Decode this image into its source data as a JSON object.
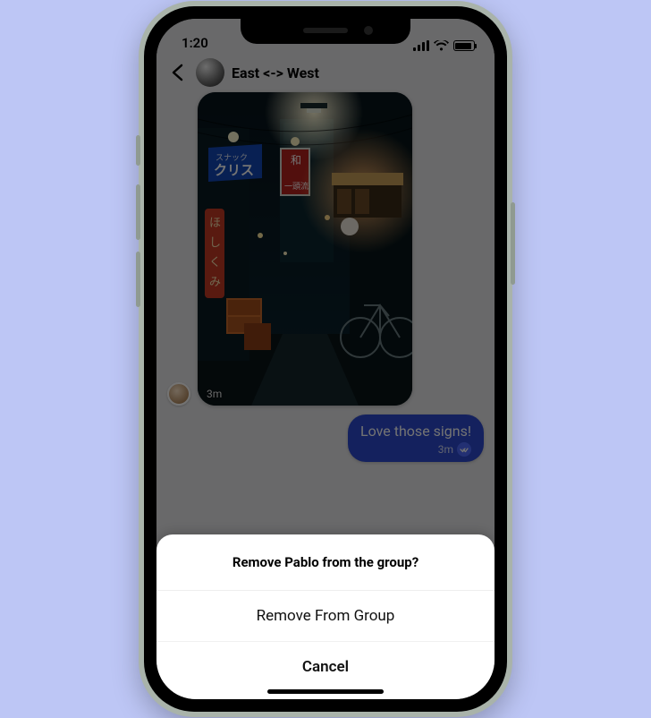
{
  "statusbar": {
    "time": "1:20"
  },
  "chat": {
    "title": "East <-> West",
    "image_message_time": "3m",
    "reply_text": "Love those signs!",
    "reply_time": "3m"
  },
  "alley_image": {
    "sign_blue_top": "スナック",
    "sign_blue_main": "クリス",
    "sign_red_top": "和",
    "sign_red_main": "一頭流",
    "lantern_a": "ほ",
    "lantern_b": "し",
    "lantern_c": "く",
    "lantern_d": "み"
  },
  "sheet": {
    "title": "Remove Pablo from the group?",
    "remove": "Remove From Group",
    "cancel": "Cancel"
  },
  "colors": {
    "page_bg": "#bdc6f5",
    "bubble_blue": "#2e4bd0"
  }
}
